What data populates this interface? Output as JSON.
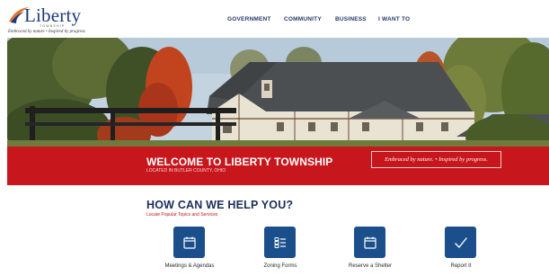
{
  "header": {
    "logo": {
      "name": "Liberty",
      "sub": "TOWNSHIP",
      "tagline": "Embraced by nature • Inspired by progress"
    },
    "nav": [
      {
        "label": "GOVERNMENT"
      },
      {
        "label": "COMMUNITY"
      },
      {
        "label": "BUSINESS"
      },
      {
        "label": "I WANT TO"
      }
    ]
  },
  "banner": {
    "title": "WELCOME TO LIBERTY TOWNSHIP",
    "subtitle": "LOCATED IN BUTLER COUNTY, OHIO",
    "tagline": "Embraced by nature. • Inspired by progress."
  },
  "help": {
    "title": "HOW CAN WE HELP YOU?",
    "subtitle": "Locate Popular Topics and Services",
    "services": [
      {
        "label": "Meetings & Agendas",
        "icon": "calendar-icon"
      },
      {
        "label": "Zoning Forms",
        "icon": "list-icon"
      },
      {
        "label": "Reserve a Shelter",
        "icon": "calendar-icon"
      },
      {
        "label": "Report It",
        "icon": "checkmark-icon"
      }
    ]
  },
  "colors": {
    "brand_red": "#c8161d",
    "navy": "#1a2e5a",
    "icon_blue": "#1b4f8c",
    "nav_text": "#273a68"
  }
}
